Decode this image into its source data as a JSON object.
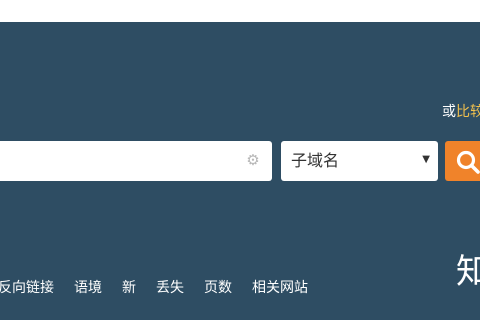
{
  "header": {
    "compare_prefix": "或",
    "compare_highlight": "比较"
  },
  "search": {
    "value": "",
    "placeholder": "",
    "settings_icon": "gear-icon",
    "select_value": "子域名",
    "button_icon": "search-icon"
  },
  "nav": {
    "items": [
      {
        "label": "反向链接"
      },
      {
        "label": "语境"
      },
      {
        "label": "新"
      },
      {
        "label": "丢失"
      },
      {
        "label": "页数"
      },
      {
        "label": "相关网站"
      }
    ]
  },
  "brand": {
    "glyph": "知"
  },
  "colors": {
    "background": "#2e4d63",
    "accent": "#f0832a",
    "link_highlight": "#f2c14e"
  }
}
